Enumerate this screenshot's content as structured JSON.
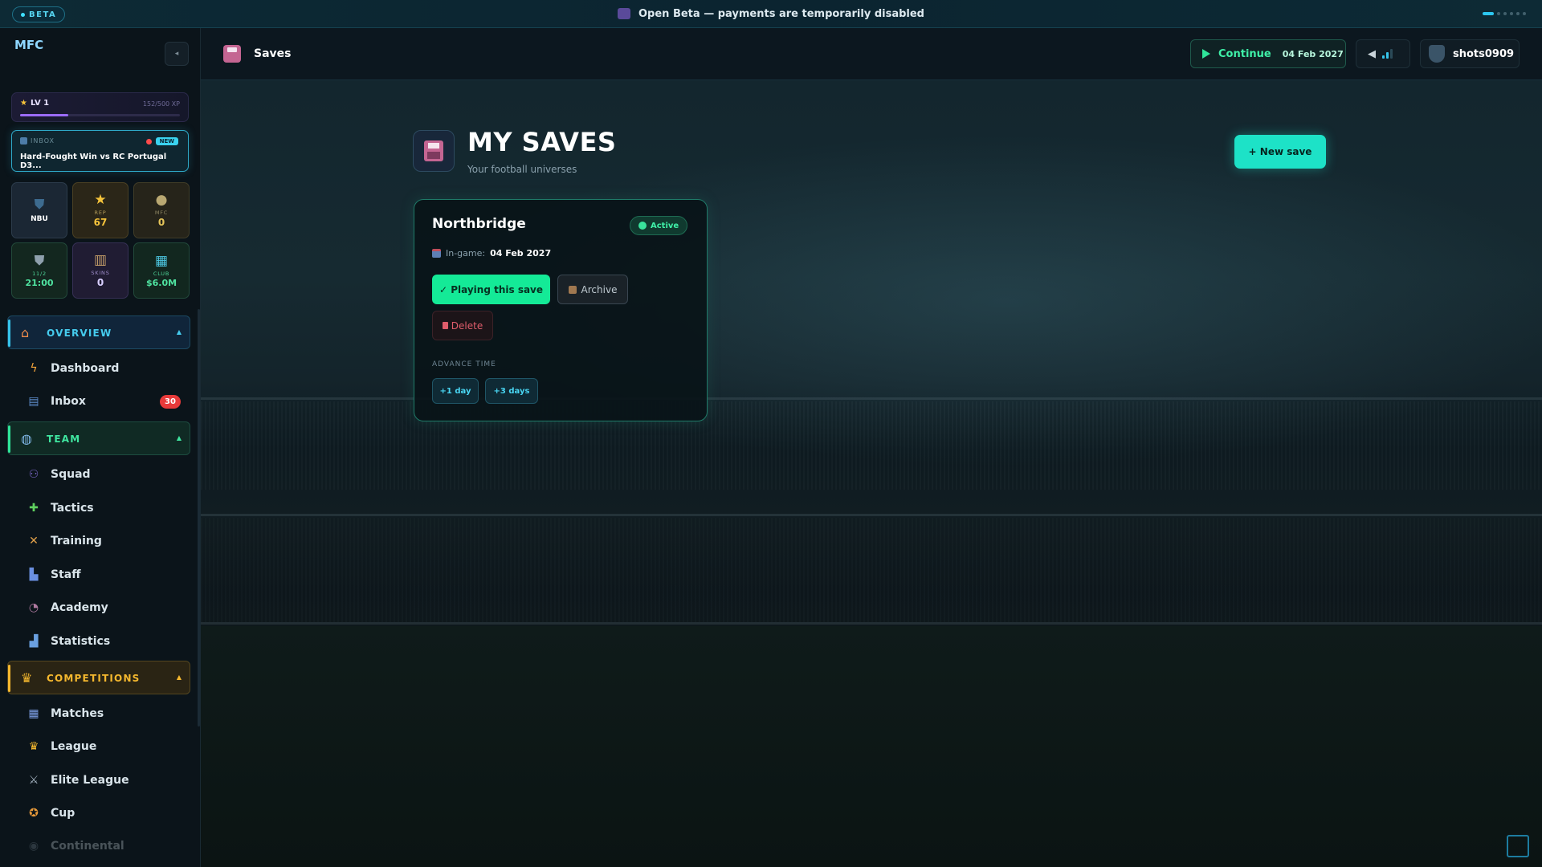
{
  "banner": {
    "beta_label": "BETA",
    "text": "Open Beta — payments are temporarily disabled"
  },
  "sidebar": {
    "logo_text": "MFC",
    "level": {
      "label": "LV 1",
      "xp": "152/500 XP",
      "progress": 0.304
    },
    "inbox_card": {
      "label": "INBOX",
      "badge": "NEW",
      "title": "Hard-Fought Win vs RC Portugal D3..."
    },
    "tiles": [
      {
        "label": "",
        "value": "NBU",
        "icon": "club-crest-icon"
      },
      {
        "label": "REP",
        "value": "67",
        "icon": "star-icon"
      },
      {
        "label": "MFC",
        "value": "0",
        "icon": "coin-icon"
      },
      {
        "label": "11/2",
        "value": "21:00",
        "icon": "next-match-shield-icon"
      },
      {
        "label": "SKINS",
        "value": "0",
        "icon": "skins-icon"
      },
      {
        "label": "CLUB",
        "value": "$6.0M",
        "icon": "club-money-icon"
      }
    ],
    "sections": {
      "overview": {
        "label": "OVERVIEW",
        "icon": "house-icon"
      },
      "team": {
        "label": "TEAM",
        "icon": "ball-icon"
      },
      "competitions": {
        "label": "COMPETITIONS",
        "icon": "trophy-icon"
      }
    },
    "items": {
      "dashboard": {
        "label": "Dashboard",
        "icon": "bolt-icon"
      },
      "inbox": {
        "label": "Inbox",
        "icon": "mailbox-icon",
        "badge": "30"
      },
      "squad": {
        "label": "Squad",
        "icon": "people-icon"
      },
      "tactics": {
        "label": "Tactics",
        "icon": "puzzle-icon"
      },
      "training": {
        "label": "Training",
        "icon": "dumbbell-icon"
      },
      "staff": {
        "label": "Staff",
        "icon": "staff-icon"
      },
      "academy": {
        "label": "Academy",
        "icon": "academy-icon"
      },
      "statistics": {
        "label": "Statistics",
        "icon": "chart-icon"
      },
      "matches": {
        "label": "Matches",
        "icon": "calendar-icon"
      },
      "league": {
        "label": "League",
        "icon": "trophy-icon"
      },
      "elite_league": {
        "label": "Elite League",
        "icon": "swords-icon"
      },
      "cup": {
        "label": "Cup",
        "icon": "medal-icon"
      },
      "continental": {
        "label": "Continental",
        "icon": "globe-icon"
      }
    }
  },
  "header": {
    "title": "Saves",
    "continue_label": "Continue",
    "continue_date": "04 Feb 2027",
    "username": "shots0909"
  },
  "main": {
    "title": "MY SAVES",
    "subtitle": "Your football universes",
    "new_save_label": "+ New save",
    "save": {
      "name": "Northbridge",
      "status": "Active",
      "ingame_label": "In-game:",
      "ingame_date": "04 Feb 2027",
      "playing_label": "✓ Playing this save",
      "archive_label": "Archive",
      "delete_label": "Delete",
      "advance_label": "ADVANCE TIME",
      "advance_options": [
        "+1 day",
        "+3 days"
      ]
    }
  },
  "colors": {
    "accent_cyan": "#1de2c7",
    "accent_green": "#14ea97",
    "danger": "#e05d6b",
    "badge_red": "#e83a3a",
    "competitions_gold": "#f5b82e"
  }
}
